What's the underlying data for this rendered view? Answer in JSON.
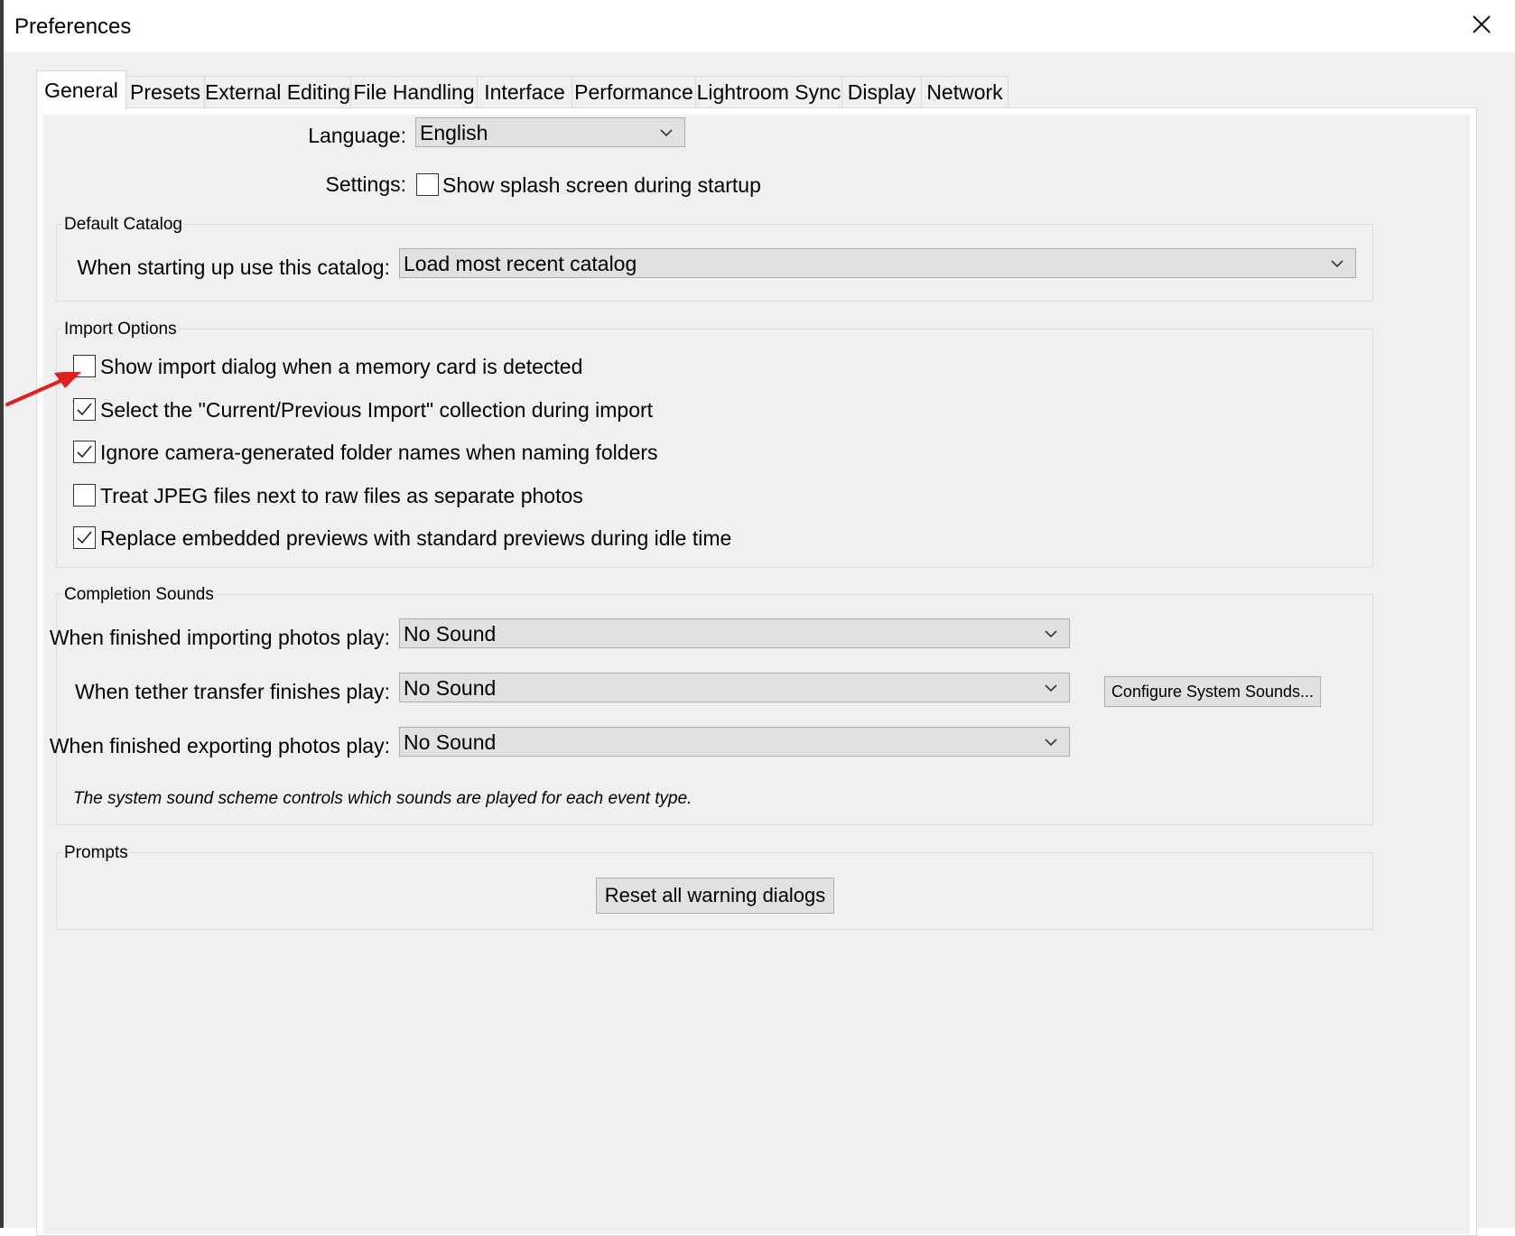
{
  "window": {
    "title": "Preferences"
  },
  "tabs": [
    {
      "label": "General",
      "active": true
    },
    {
      "label": "Presets"
    },
    {
      "label": "External Editing"
    },
    {
      "label": "File Handling"
    },
    {
      "label": "Interface"
    },
    {
      "label": "Performance"
    },
    {
      "label": "Lightroom Sync"
    },
    {
      "label": "Display"
    },
    {
      "label": "Network"
    }
  ],
  "general": {
    "language_label": "Language:",
    "language_value": "English",
    "settings_label": "Settings:",
    "splash": {
      "label": "Show splash screen during startup",
      "checked": false
    }
  },
  "default_catalog": {
    "title": "Default Catalog",
    "label": "When starting up use this catalog:",
    "value": "Load most recent catalog"
  },
  "import_options": {
    "title": "Import Options",
    "items": [
      {
        "label": "Show import dialog when a memory card is detected",
        "checked": false
      },
      {
        "label": "Select the \"Current/Previous Import\" collection during import",
        "checked": true
      },
      {
        "label": "Ignore camera-generated folder names when naming folders",
        "checked": true
      },
      {
        "label": "Treat JPEG files next to raw files as separate photos",
        "checked": false
      },
      {
        "label": "Replace embedded previews with standard previews during idle time",
        "checked": true
      }
    ]
  },
  "completion_sounds": {
    "title": "Completion Sounds",
    "importing_label": "When finished importing photos play:",
    "importing_value": "No Sound",
    "tether_label": "When tether transfer finishes play:",
    "tether_value": "No Sound",
    "exporting_label": "When finished exporting photos play:",
    "exporting_value": "No Sound",
    "configure_button": "Configure System Sounds...",
    "note": "The system sound scheme controls which sounds are played for each event type."
  },
  "prompts": {
    "title": "Prompts",
    "reset_button": "Reset all warning dialogs"
  },
  "colors": {
    "dialog_bg": "#f0f0f0",
    "control_bg": "#e1e1e1",
    "annotation_arrow": "#e02020"
  },
  "icons": {
    "close": "close-icon",
    "dropdown": "chevron-down-icon",
    "check": "checkmark-icon",
    "annotation": "red-arrow-icon"
  }
}
